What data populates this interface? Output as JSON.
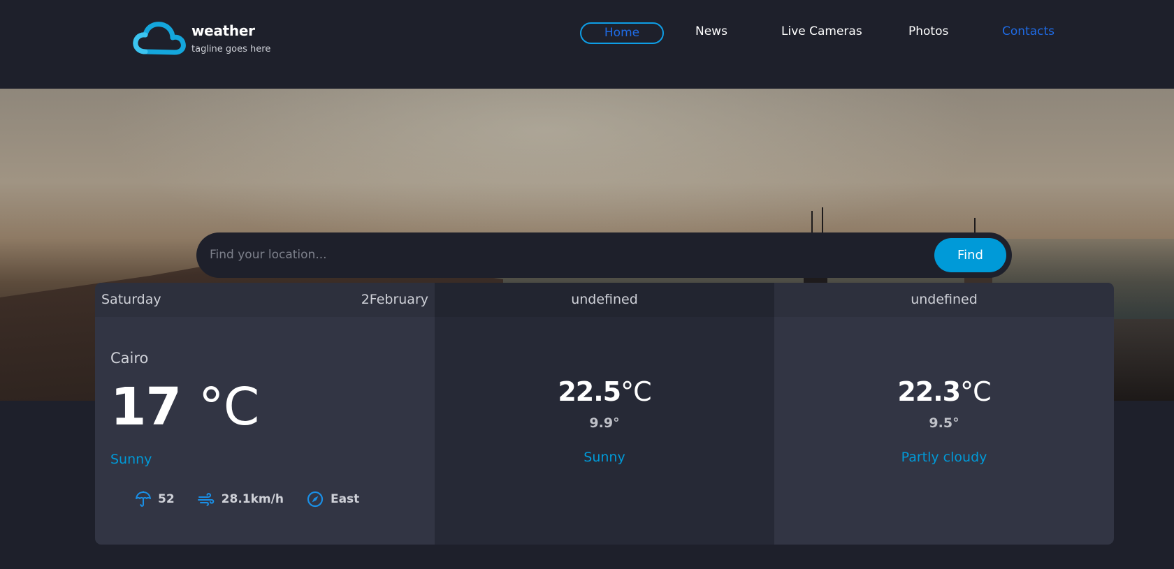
{
  "brand": {
    "name": "weather",
    "tagline": "tagline goes here"
  },
  "nav": {
    "home": "Home",
    "news": "News",
    "cameras": "Live Cameras",
    "photos": "Photos",
    "contacts": "Contacts"
  },
  "search": {
    "placeholder": "Find your location...",
    "button": "Find"
  },
  "colors": {
    "accent": "#009ad8",
    "nav_active": "#1f6be5",
    "background": "#1e202b"
  },
  "forecast": {
    "today": {
      "day": "Saturday",
      "date": "2February",
      "location": "Cairo",
      "temp": "17 ",
      "unit": "°C",
      "condition": "Sunny",
      "stats": [
        {
          "icon": "umbrella-icon",
          "value": "52"
        },
        {
          "icon": "wind-icon",
          "value": "28.1km/h"
        },
        {
          "icon": "compass-icon",
          "value": "East"
        }
      ]
    },
    "day2": {
      "title": "undefined",
      "max": "22.5",
      "unit": "°C",
      "min": "9.9°",
      "condition": "Sunny"
    },
    "day3": {
      "title": "undefined",
      "max": "22.3",
      "unit": "°C",
      "min": "9.5°",
      "condition": "Partly cloudy"
    }
  }
}
